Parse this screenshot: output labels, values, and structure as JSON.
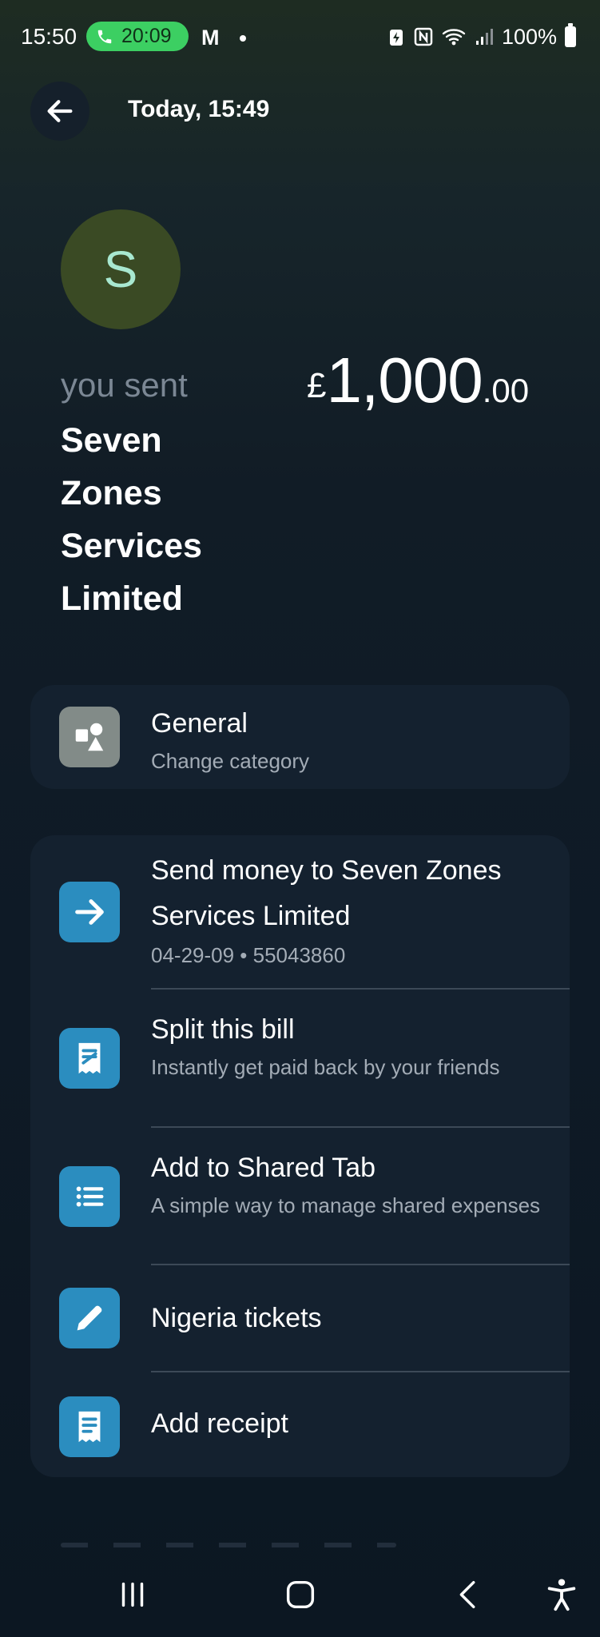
{
  "status_bar": {
    "time": "15:50",
    "call_timer": "20:09",
    "app_letter": "M",
    "battery": "100%"
  },
  "header": {
    "back_icon": "arrow-left-icon",
    "title": "Today, 15:49"
  },
  "transaction": {
    "avatar_initial": "S",
    "direction_label": "you sent",
    "payee": "Seven Zones Services Limited",
    "amount_currency": "£",
    "amount_main": "1,000",
    "amount_decimal": ".00"
  },
  "category_card": {
    "icon": "shapes-icon",
    "title": "General",
    "subtitle": "Change category"
  },
  "actions": [
    {
      "icon": "arrow-right-icon",
      "title": "Send money to Seven Zones Services Limited",
      "subtitle": "04-29-09 • 55043860"
    },
    {
      "icon": "split-bill-icon",
      "title": "Split this bill",
      "subtitle": "Instantly get paid back by your friends"
    },
    {
      "icon": "list-icon",
      "title": "Add to Shared Tab",
      "subtitle": "A simple way to manage shared expenses"
    },
    {
      "icon": "pencil-icon",
      "title": "Nigeria tickets",
      "subtitle": ""
    },
    {
      "icon": "receipt-icon",
      "title": "Add receipt",
      "subtitle": ""
    }
  ],
  "colors": {
    "accent_blue": "#2b8dbf",
    "card_bg": "#14212f",
    "call_green": "#3ccf62"
  }
}
